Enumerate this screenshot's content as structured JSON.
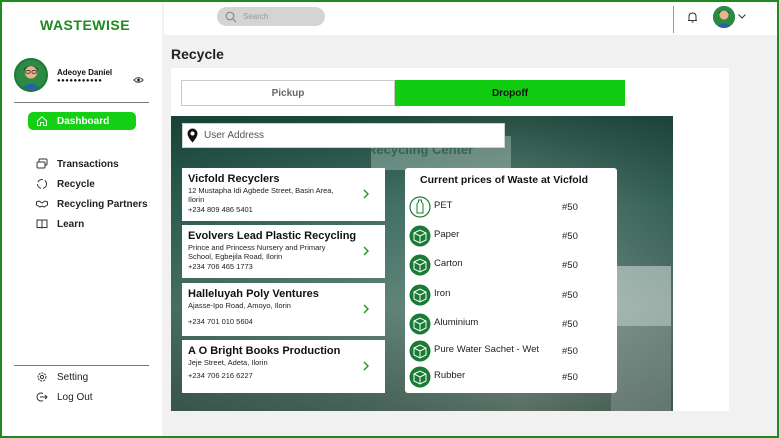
{
  "app": {
    "logo": "WASTEWISE"
  },
  "profile": {
    "name": "Adeoye Daniel",
    "masked_value": "●●●●●●●●●●●"
  },
  "sidebar": {
    "dashboard_label": "Dashboard",
    "items": [
      {
        "label": "Transactions",
        "icon": "transactions-icon"
      },
      {
        "label": "Recycle",
        "icon": "recycle-icon"
      },
      {
        "label": "Recycling Partners",
        "icon": "handshake-icon"
      },
      {
        "label": "Learn",
        "icon": "book-icon"
      }
    ],
    "bottom": [
      {
        "label": "Setting",
        "icon": "gear-icon"
      },
      {
        "label": "Log Out",
        "icon": "logout-icon"
      }
    ]
  },
  "header": {
    "search_placeholder": "Search"
  },
  "page": {
    "title": "Recycle",
    "tabs": [
      {
        "label": "Pickup",
        "active": false
      },
      {
        "label": "Dropoff",
        "active": true
      }
    ],
    "address_placeholder": "User Address",
    "map_sign": "Recycling Center"
  },
  "locations": [
    {
      "name": "Vicfold Recyclers",
      "address": "12 Mustapha Idi Agbede Street, Basin Area, Ilorin",
      "phone": "+234 809 486 5401"
    },
    {
      "name": "Evolvers Lead Plastic Recycling",
      "address": "Prince and Princess Nursery and Primary School, Egbejila Road, Ilorin",
      "phone": "+234 706 465 1773"
    },
    {
      "name": "Halleluyah Poly Ventures",
      "address": "Ajasse-Ipo Road, Amoyo, Ilorin",
      "phone": "+234 701 010 5604"
    },
    {
      "name": "A O Bright Books Production",
      "address": "Jeje Street, Adeta, Ilorin",
      "phone": "+234 706 216 6227"
    }
  ],
  "prices": {
    "title": "Current prices of Waste at Vicfold",
    "items": [
      {
        "name": "PET",
        "price": "#50",
        "icon": "bottle-icon"
      },
      {
        "name": "Paper",
        "price": "#50",
        "icon": "box-icon"
      },
      {
        "name": "Carton",
        "price": "#50",
        "icon": "box-icon"
      },
      {
        "name": "Iron",
        "price": "#50",
        "icon": "box-icon"
      },
      {
        "name": "Aluminium",
        "price": "#50",
        "icon": "box-icon"
      },
      {
        "name": "Pure Water Sachet - Wet",
        "price": "#50",
        "icon": "box-icon"
      },
      {
        "name": "Rubber",
        "price": "#50",
        "icon": "box-icon"
      }
    ]
  },
  "colors": {
    "brand_green": "#14d014",
    "logo_green": "#1c8a1c",
    "icon_green": "#1a7b34"
  }
}
